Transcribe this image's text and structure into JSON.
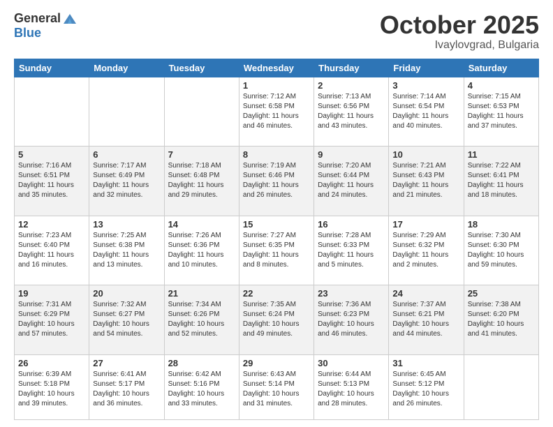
{
  "logo": {
    "general": "General",
    "blue": "Blue"
  },
  "title": "October 2025",
  "location": "Ivaylovgrad, Bulgaria",
  "days_header": [
    "Sunday",
    "Monday",
    "Tuesday",
    "Wednesday",
    "Thursday",
    "Friday",
    "Saturday"
  ],
  "weeks": [
    [
      {
        "day": "",
        "info": ""
      },
      {
        "day": "",
        "info": ""
      },
      {
        "day": "",
        "info": ""
      },
      {
        "day": "1",
        "info": "Sunrise: 7:12 AM\nSunset: 6:58 PM\nDaylight: 11 hours\nand 46 minutes."
      },
      {
        "day": "2",
        "info": "Sunrise: 7:13 AM\nSunset: 6:56 PM\nDaylight: 11 hours\nand 43 minutes."
      },
      {
        "day": "3",
        "info": "Sunrise: 7:14 AM\nSunset: 6:54 PM\nDaylight: 11 hours\nand 40 minutes."
      },
      {
        "day": "4",
        "info": "Sunrise: 7:15 AM\nSunset: 6:53 PM\nDaylight: 11 hours\nand 37 minutes."
      }
    ],
    [
      {
        "day": "5",
        "info": "Sunrise: 7:16 AM\nSunset: 6:51 PM\nDaylight: 11 hours\nand 35 minutes."
      },
      {
        "day": "6",
        "info": "Sunrise: 7:17 AM\nSunset: 6:49 PM\nDaylight: 11 hours\nand 32 minutes."
      },
      {
        "day": "7",
        "info": "Sunrise: 7:18 AM\nSunset: 6:48 PM\nDaylight: 11 hours\nand 29 minutes."
      },
      {
        "day": "8",
        "info": "Sunrise: 7:19 AM\nSunset: 6:46 PM\nDaylight: 11 hours\nand 26 minutes."
      },
      {
        "day": "9",
        "info": "Sunrise: 7:20 AM\nSunset: 6:44 PM\nDaylight: 11 hours\nand 24 minutes."
      },
      {
        "day": "10",
        "info": "Sunrise: 7:21 AM\nSunset: 6:43 PM\nDaylight: 11 hours\nand 21 minutes."
      },
      {
        "day": "11",
        "info": "Sunrise: 7:22 AM\nSunset: 6:41 PM\nDaylight: 11 hours\nand 18 minutes."
      }
    ],
    [
      {
        "day": "12",
        "info": "Sunrise: 7:23 AM\nSunset: 6:40 PM\nDaylight: 11 hours\nand 16 minutes."
      },
      {
        "day": "13",
        "info": "Sunrise: 7:25 AM\nSunset: 6:38 PM\nDaylight: 11 hours\nand 13 minutes."
      },
      {
        "day": "14",
        "info": "Sunrise: 7:26 AM\nSunset: 6:36 PM\nDaylight: 11 hours\nand 10 minutes."
      },
      {
        "day": "15",
        "info": "Sunrise: 7:27 AM\nSunset: 6:35 PM\nDaylight: 11 hours\nand 8 minutes."
      },
      {
        "day": "16",
        "info": "Sunrise: 7:28 AM\nSunset: 6:33 PM\nDaylight: 11 hours\nand 5 minutes."
      },
      {
        "day": "17",
        "info": "Sunrise: 7:29 AM\nSunset: 6:32 PM\nDaylight: 11 hours\nand 2 minutes."
      },
      {
        "day": "18",
        "info": "Sunrise: 7:30 AM\nSunset: 6:30 PM\nDaylight: 10 hours\nand 59 minutes."
      }
    ],
    [
      {
        "day": "19",
        "info": "Sunrise: 7:31 AM\nSunset: 6:29 PM\nDaylight: 10 hours\nand 57 minutes."
      },
      {
        "day": "20",
        "info": "Sunrise: 7:32 AM\nSunset: 6:27 PM\nDaylight: 10 hours\nand 54 minutes."
      },
      {
        "day": "21",
        "info": "Sunrise: 7:34 AM\nSunset: 6:26 PM\nDaylight: 10 hours\nand 52 minutes."
      },
      {
        "day": "22",
        "info": "Sunrise: 7:35 AM\nSunset: 6:24 PM\nDaylight: 10 hours\nand 49 minutes."
      },
      {
        "day": "23",
        "info": "Sunrise: 7:36 AM\nSunset: 6:23 PM\nDaylight: 10 hours\nand 46 minutes."
      },
      {
        "day": "24",
        "info": "Sunrise: 7:37 AM\nSunset: 6:21 PM\nDaylight: 10 hours\nand 44 minutes."
      },
      {
        "day": "25",
        "info": "Sunrise: 7:38 AM\nSunset: 6:20 PM\nDaylight: 10 hours\nand 41 minutes."
      }
    ],
    [
      {
        "day": "26",
        "info": "Sunrise: 6:39 AM\nSunset: 5:18 PM\nDaylight: 10 hours\nand 39 minutes."
      },
      {
        "day": "27",
        "info": "Sunrise: 6:41 AM\nSunset: 5:17 PM\nDaylight: 10 hours\nand 36 minutes."
      },
      {
        "day": "28",
        "info": "Sunrise: 6:42 AM\nSunset: 5:16 PM\nDaylight: 10 hours\nand 33 minutes."
      },
      {
        "day": "29",
        "info": "Sunrise: 6:43 AM\nSunset: 5:14 PM\nDaylight: 10 hours\nand 31 minutes."
      },
      {
        "day": "30",
        "info": "Sunrise: 6:44 AM\nSunset: 5:13 PM\nDaylight: 10 hours\nand 28 minutes."
      },
      {
        "day": "31",
        "info": "Sunrise: 6:45 AM\nSunset: 5:12 PM\nDaylight: 10 hours\nand 26 minutes."
      },
      {
        "day": "",
        "info": ""
      }
    ]
  ]
}
